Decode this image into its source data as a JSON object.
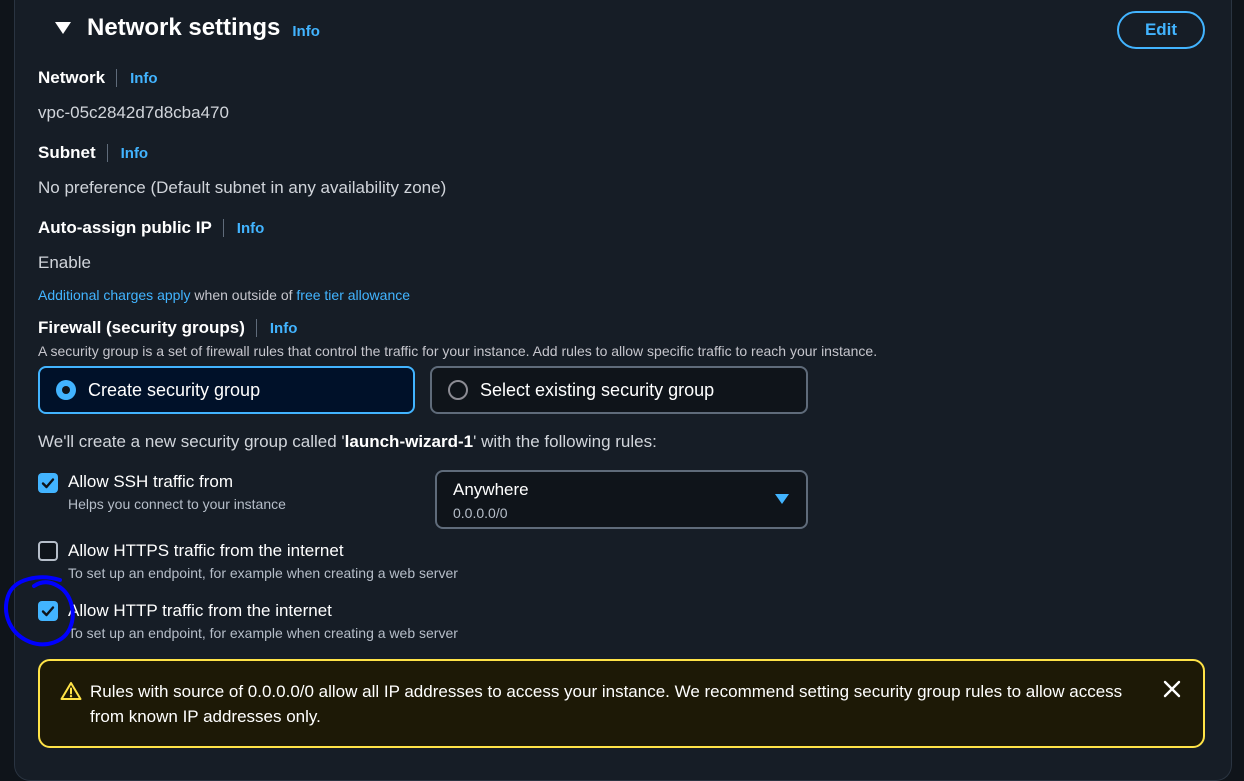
{
  "section": {
    "title": "Network settings",
    "info_label": "Info",
    "edit_label": "Edit"
  },
  "network": {
    "label": "Network",
    "info": "Info",
    "value": "vpc-05c2842d7d8cba470"
  },
  "subnet": {
    "label": "Subnet",
    "info": "Info",
    "value": "No preference (Default subnet in any availability zone)"
  },
  "public_ip": {
    "label": "Auto-assign public IP",
    "info": "Info",
    "value": "Enable",
    "charges_link": "Additional charges apply",
    "charges_mid": " when outside of ",
    "free_tier_link": "free tier allowance"
  },
  "firewall": {
    "label": "Firewall (security groups)",
    "info": "Info",
    "description": "A security group is a set of firewall rules that control the traffic for your instance. Add rules to allow specific traffic to reach your instance.",
    "options": [
      {
        "label": "Create security group",
        "selected": true
      },
      {
        "label": "Select existing security group",
        "selected": false
      }
    ],
    "create_note_prefix": "We'll create a new security group called '",
    "create_note_name": "launch-wizard-1",
    "create_note_suffix": "' with the following rules:"
  },
  "rules": [
    {
      "label": "Allow SSH traffic from",
      "description": "Helps you connect to your instance",
      "checked": true
    },
    {
      "label": "Allow HTTPS traffic from the internet",
      "description": "To set up an endpoint, for example when creating a web server",
      "checked": false
    },
    {
      "label": "Allow HTTP traffic from the internet",
      "description": "To set up an endpoint, for example when creating a web server",
      "checked": true
    }
  ],
  "ssh_source": {
    "selected": "Anywhere",
    "secondary": "0.0.0.0/0"
  },
  "alert": {
    "text": "Rules with source of 0.0.0.0/0 allow all IP addresses to access your instance. We recommend setting security group rules to allow access from known IP addresses only."
  },
  "colors": {
    "accent": "#42b4ff",
    "warning": "#ffe347",
    "annotation": "#0000ff",
    "background": "#0f141a"
  },
  "icons": {
    "expand": "caret-down-icon",
    "radio": "radio-icon",
    "checkbox": "checkmark-icon",
    "dropdown": "caret-down-icon",
    "warning": "warning-triangle-icon",
    "close": "close-icon"
  }
}
